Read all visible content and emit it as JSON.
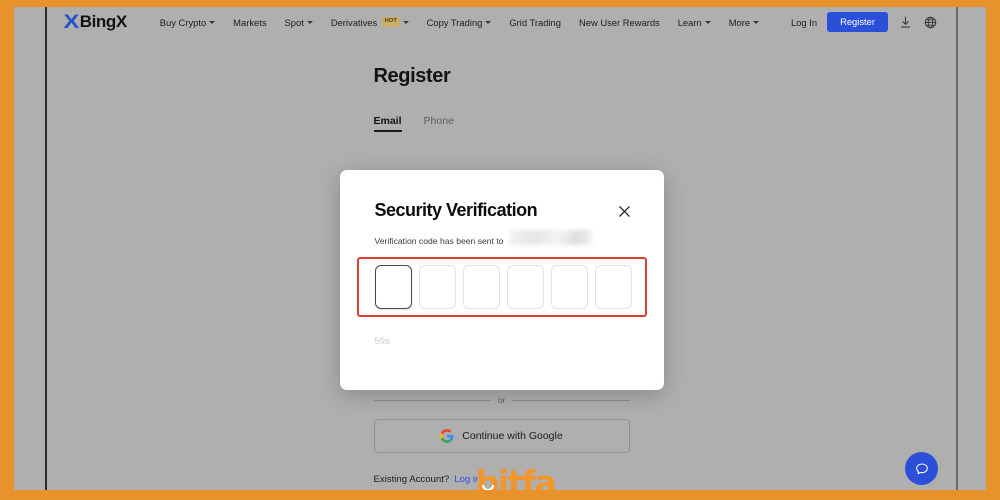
{
  "nav": {
    "brand": {
      "mark": "X",
      "name": "BingX"
    },
    "items": [
      {
        "label": "Buy Crypto",
        "caret": true,
        "badge": null
      },
      {
        "label": "Markets",
        "caret": false,
        "badge": null
      },
      {
        "label": "Spot",
        "caret": true,
        "badge": null
      },
      {
        "label": "Derivatives",
        "caret": true,
        "badge": "HOT"
      },
      {
        "label": "Copy Trading",
        "caret": true,
        "badge": null
      },
      {
        "label": "Grid Trading",
        "caret": false,
        "badge": null
      },
      {
        "label": "New User Rewards",
        "caret": false,
        "badge": null
      },
      {
        "label": "Learn",
        "caret": true,
        "badge": null
      },
      {
        "label": "More",
        "caret": true,
        "badge": null
      }
    ],
    "login_label": "Log In",
    "register_label": "Register",
    "download_icon": "download-icon",
    "language_icon": "globe-icon"
  },
  "register_page": {
    "title": "Register",
    "tabs": [
      {
        "label": "Email",
        "active": true
      },
      {
        "label": "Phone",
        "active": false
      }
    ],
    "or_text": "or",
    "google_button": "Continue with Google",
    "google_icon": "google-g-icon",
    "existing_text": "Existing Account?",
    "login_link": "Log in"
  },
  "modal": {
    "title": "Security Verification",
    "close_icon": "close-icon",
    "subtitle": "Verification code has been sent to",
    "redacted_recipient": "",
    "otp_length": 6,
    "otp_values": [
      "",
      "",
      "",
      "",
      "",
      ""
    ],
    "otp_focused_index": 0,
    "timer": "59s",
    "highlight_color": "#E03C33"
  },
  "watermark": {
    "text": "bitfa",
    "color": "#F2952A"
  },
  "chat": {
    "icon": "chat-bubble-icon",
    "color": "#2B4FD8"
  },
  "theme": {
    "frame_color": "#E8922B",
    "page_bg": "#AFAFAF",
    "brand_blue": "#2B4FD8",
    "badge_bg": "#C8AD6B"
  }
}
